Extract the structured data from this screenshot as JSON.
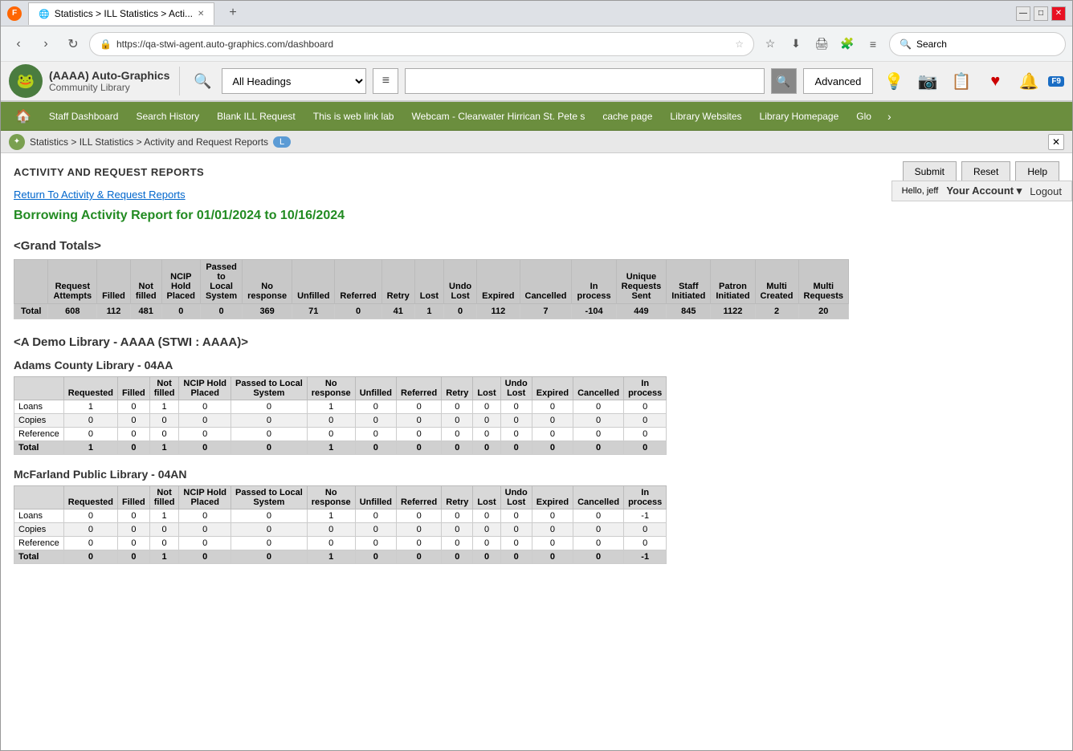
{
  "browser": {
    "tab_title": "Statistics > ILL Statistics > Acti...",
    "url": "https://qa-stwi-agent.auto-graphics.com/dashboard",
    "search_placeholder": "Search"
  },
  "toolbar": {
    "logo_alt": "frog",
    "app_name": "(AAAA) Auto-Graphics",
    "app_sub": "Community Library",
    "heading_options": [
      "All Headings"
    ],
    "heading_selected": "All Headings",
    "search_placeholder": "",
    "advanced_label": "Advanced",
    "search_label": "Search"
  },
  "nav": {
    "items": [
      "Staff Dashboard",
      "Search History",
      "Blank ILL Request",
      "This is web link lab",
      "Webcam - Clearwater Hirricam St. Pete s",
      "cache page",
      "Library Websites",
      "Library Homepage",
      "Glo"
    ]
  },
  "account": {
    "hello": "Hello, jeff",
    "account_label": "Your Account",
    "logout_label": "Logout"
  },
  "breadcrumb": {
    "path": "Statistics > ILL Statistics > Activity and Request Reports",
    "badge": "L"
  },
  "content": {
    "section_title": "ACTIVITY AND REQUEST REPORTS",
    "submit_label": "Submit",
    "reset_label": "Reset",
    "help_label": "Help",
    "return_link": "Return To Activity & Request Reports",
    "report_title": "Borrowing Activity Report for 01/01/2024 to 10/16/2024",
    "grand_totals_label": "<Grand Totals>",
    "grand_table": {
      "headers": [
        "Request Attempts",
        "Filled",
        "Not filled",
        "NCIP Hold Placed",
        "Passed to Local System",
        "No response",
        "Unfilled",
        "Referred",
        "Retry",
        "Lost",
        "Undo Lost",
        "Expired",
        "Cancelled",
        "In process",
        "Unique Requests Sent",
        "Staff Initiated",
        "Patron Initiated",
        "Multi Created",
        "Multi Requests"
      ],
      "rows": [
        {
          "label": "Total",
          "values": [
            "608",
            "112",
            "481",
            "0",
            "0",
            "369",
            "71",
            "0",
            "41",
            "1",
            "0",
            "112",
            "7",
            "-104",
            "449",
            "845",
            "1122",
            "2",
            "20"
          ]
        }
      ]
    },
    "section_a_label": "<A Demo Library - AAAA (STWI : AAAA)>",
    "adams_library": {
      "title": "Adams County Library - 04AA",
      "headers": [
        "Requested",
        "Filled",
        "Not filled",
        "NCIP Hold Placed",
        "Passed to Local System",
        "No response",
        "Unfilled",
        "Referred",
        "Retry",
        "Lost",
        "Undo Lost",
        "Expired",
        "Cancelled",
        "In process"
      ],
      "rows": [
        {
          "label": "Loans",
          "values": [
            "1",
            "0",
            "1",
            "0",
            "0",
            "1",
            "0",
            "0",
            "0",
            "0",
            "0",
            "0",
            "0",
            "0"
          ]
        },
        {
          "label": "Copies",
          "values": [
            "0",
            "0",
            "0",
            "0",
            "0",
            "0",
            "0",
            "0",
            "0",
            "0",
            "0",
            "0",
            "0",
            "0"
          ]
        },
        {
          "label": "Reference",
          "values": [
            "0",
            "0",
            "0",
            "0",
            "0",
            "0",
            "0",
            "0",
            "0",
            "0",
            "0",
            "0",
            "0",
            "0"
          ]
        },
        {
          "label": "Total",
          "values": [
            "1",
            "0",
            "1",
            "0",
            "0",
            "1",
            "0",
            "0",
            "0",
            "0",
            "0",
            "0",
            "0",
            "0"
          ]
        }
      ]
    },
    "mcfarland_library": {
      "title": "McFarland Public Library - 04AN",
      "headers": [
        "Requested",
        "Filled",
        "Not filled",
        "NCIP Hold Placed",
        "Passed to Local System",
        "No response",
        "Unfilled",
        "Referred",
        "Retry",
        "Lost",
        "Undo Lost",
        "Expired",
        "Cancelled",
        "In process"
      ],
      "rows": [
        {
          "label": "Loans",
          "values": [
            "0",
            "0",
            "1",
            "0",
            "0",
            "1",
            "0",
            "0",
            "0",
            "0",
            "0",
            "0",
            "0",
            "-1"
          ]
        },
        {
          "label": "Copies",
          "values": [
            "0",
            "0",
            "0",
            "0",
            "0",
            "0",
            "0",
            "0",
            "0",
            "0",
            "0",
            "0",
            "0",
            "0"
          ]
        },
        {
          "label": "Reference",
          "values": [
            "0",
            "0",
            "0",
            "0",
            "0",
            "0",
            "0",
            "0",
            "0",
            "0",
            "0",
            "0",
            "0",
            "0"
          ]
        },
        {
          "label": "Total",
          "values": [
            "0",
            "0",
            "1",
            "0",
            "0",
            "1",
            "0",
            "0",
            "0",
            "0",
            "0",
            "0",
            "0",
            "-1"
          ]
        }
      ]
    }
  }
}
